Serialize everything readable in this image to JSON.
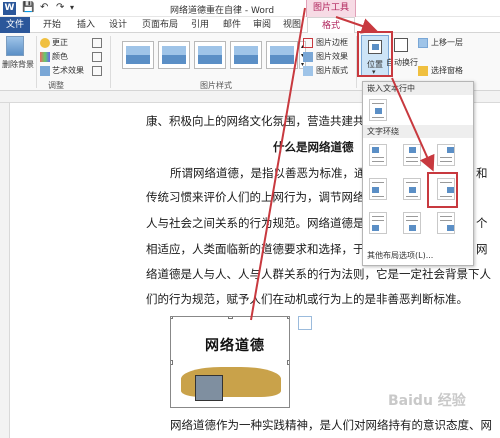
{
  "window": {
    "title": "网络道德重在自律 - Word",
    "contextual_tab": "图片工具"
  },
  "tabs": [
    "文件",
    "开始",
    "插入",
    "设计",
    "页面布局",
    "引用",
    "邮件",
    "审阅",
    "视图",
    "格式"
  ],
  "ribbon": {
    "remove_bg": "删除背景",
    "adjust": {
      "corrections": "更正",
      "color": "颜色",
      "artistic": "艺术效果",
      "label": "调整"
    },
    "picture_styles_label": "图片样式",
    "style_right": {
      "border": "图片边框",
      "effects": "图片效果",
      "layout": "图片版式"
    },
    "position": "位置",
    "wrap_text": "自动换行",
    "bring_forward": "上移一层",
    "selection_pane": "选择窗格"
  },
  "panel": {
    "inline_header": "嵌入文本行中",
    "wrap_header": "文字环绕",
    "more_options": "其他布局选项(L)..."
  },
  "document": {
    "line1": "康、积极向上的网络文化氛围，营造共建共",
    "heading": "什么是网络道德",
    "para": [
      "所谓网络道德，是指以善恶为标准，通",
      "传统习惯来评价人们的上网行为，调节网络",
      "人与社会之间关系的行为规范。网络道德是",
      "相适应，人类面临新的道德要求和选择，于",
      "络道德是人与人、人与人群关系的行为法则，它是一定社会背景下人",
      "们的行为规范，赋予人们在动机或行为上的是非善恶判断标准。"
    ],
    "right_fragments": [
      "和",
      "个",
      "网"
    ],
    "picture_caption": "网络道德",
    "bottom_line": "网络道德作为一种实践精神，是人们对网络持有的意识态度、网"
  },
  "watermark": "Baidu 经验",
  "colors": {
    "word_blue": "#2b579a",
    "context_pink": "#b0245c",
    "highlight_red": "#c8393f"
  }
}
